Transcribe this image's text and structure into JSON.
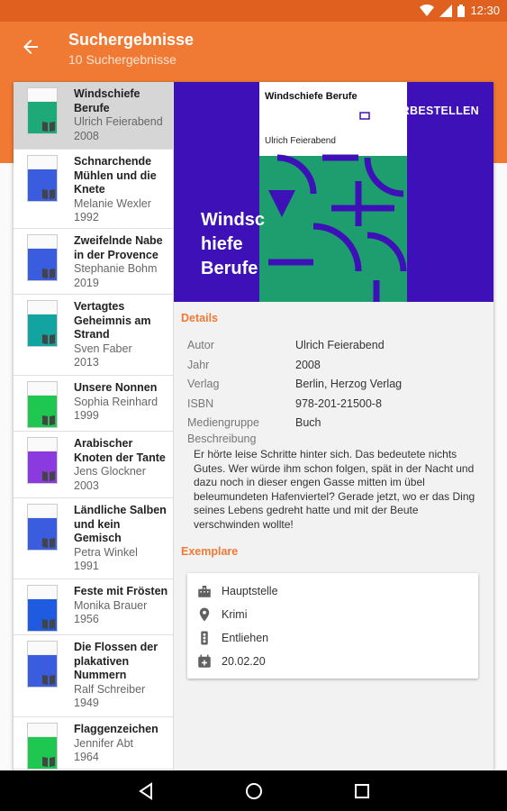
{
  "status": {
    "time": "12:30"
  },
  "toolbar": {
    "title": "Suchergebnisse",
    "subtitle": "10 Suchergebnisse"
  },
  "results": [
    {
      "title": "Windschiefe Berufe",
      "author": "Ulrich Feierabend",
      "year": "2008",
      "selected": true,
      "color": "#1eaa78"
    },
    {
      "title": "Schnarchende Mühlen und die Knete",
      "author": "Melanie Wexler",
      "year": "1992",
      "selected": false,
      "color": "#3a5de0"
    },
    {
      "title": "Zweifelnde Nabe in der Provence",
      "author": "Stephanie Bohm",
      "year": "2019",
      "selected": false,
      "color": "#3a5de0"
    },
    {
      "title": "Vertagtes Geheimnis am Strand",
      "author": "Sven Faber",
      "year": "2013",
      "selected": false,
      "color": "#12a4a0"
    },
    {
      "title": "Unsere Nonnen",
      "author": "Sophia Reinhard",
      "year": "1999",
      "selected": false,
      "color": "#1ec850"
    },
    {
      "title": "Arabischer Knoten der Tante",
      "author": "Jens Glockner",
      "year": "2003",
      "selected": false,
      "color": "#8a3adf"
    },
    {
      "title": "Ländliche Salben und kein Gemisch",
      "author": "Petra Winkel",
      "year": "1991",
      "selected": false,
      "color": "#3a5de0"
    },
    {
      "title": "Feste mit Frösten",
      "author": "Monika Brauer",
      "year": "1956",
      "selected": false,
      "color": "#1e5be0"
    },
    {
      "title": "Die Flossen der plakativen Nummern",
      "author": "Ralf Schreiber",
      "year": "1949",
      "selected": false,
      "color": "#3a5de0"
    },
    {
      "title": "Flaggenzeichen",
      "author": "Jennifer Abt",
      "year": "1964",
      "selected": false,
      "color": "#1ec850"
    }
  ],
  "detail": {
    "cover": {
      "title": "Windschiefe Berufe",
      "author": "Ulrich Feierabend"
    },
    "big_title": "Windsc hiefe Berufe",
    "reserve_label": "VORBESTELLEN",
    "details_heading": "Details",
    "fields": [
      {
        "key": "Autor",
        "value": "Ulrich Feierabend"
      },
      {
        "key": "Jahr",
        "value": "2008"
      },
      {
        "key": "Verlag",
        "value": "Berlin, Herzog Verlag"
      },
      {
        "key": "ISBN",
        "value": "978-201-21500-8"
      },
      {
        "key": "Mediengruppe",
        "value": "Buch"
      }
    ],
    "description_label": "Beschreibung",
    "description": "Er hörte leise Schritte hinter sich. Das bedeutete nichts Gutes. Wer würde ihm schon folgen, spät in der Nacht und dazu noch in dieser engen Gasse mitten im übel beleumundeten Hafenviertel? Gerade jetzt, wo er das Ding seines Lebens gedreht hatte und mit der Beute verschwinden wollte!",
    "copies_heading": "Exemplare",
    "copy": {
      "branch": "Hauptstelle",
      "location": "Krimi",
      "status": "Entliehen",
      "return_date": "20.02.20"
    }
  },
  "colors": {
    "primary": "#f07a34",
    "primary_dark": "#e0611f",
    "cover_bg": "#3e10b8",
    "cover_green": "#1e9e6e"
  }
}
